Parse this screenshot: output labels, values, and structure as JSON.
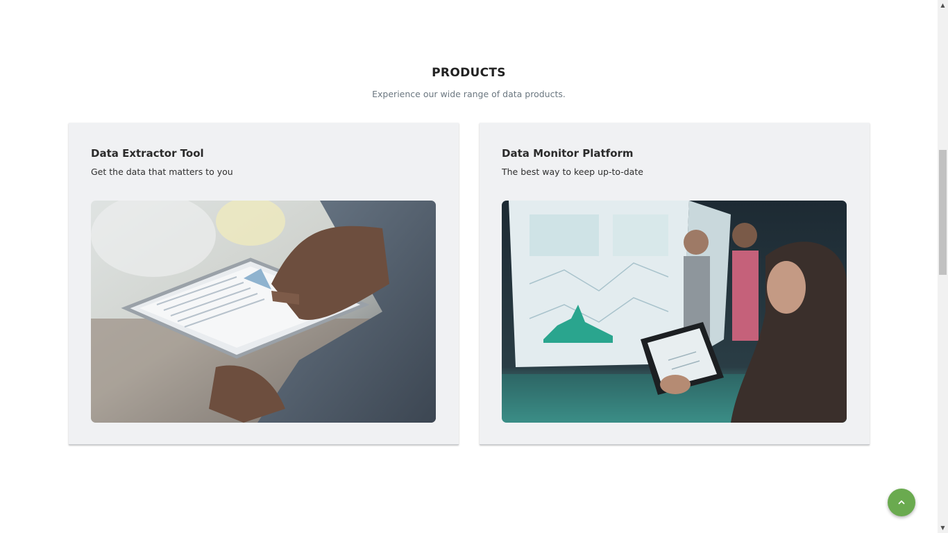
{
  "products": {
    "title": "PRODUCTS",
    "subtitle": "Experience our wide range of data products.",
    "cards": [
      {
        "title": "Data Extractor Tool",
        "description": "Get the data that matters to you",
        "image": "tablet-data-photo"
      },
      {
        "title": "Data Monitor Platform",
        "description": "The best way to keep up-to-date",
        "image": "dashboard-team-photo"
      }
    ]
  },
  "back_to_top": {
    "icon": "chevron-up-icon",
    "color": "#6aaa4f"
  },
  "colors": {
    "card_bg": "#f0f1f3",
    "title": "#222222",
    "subtitle": "#6b7780"
  }
}
